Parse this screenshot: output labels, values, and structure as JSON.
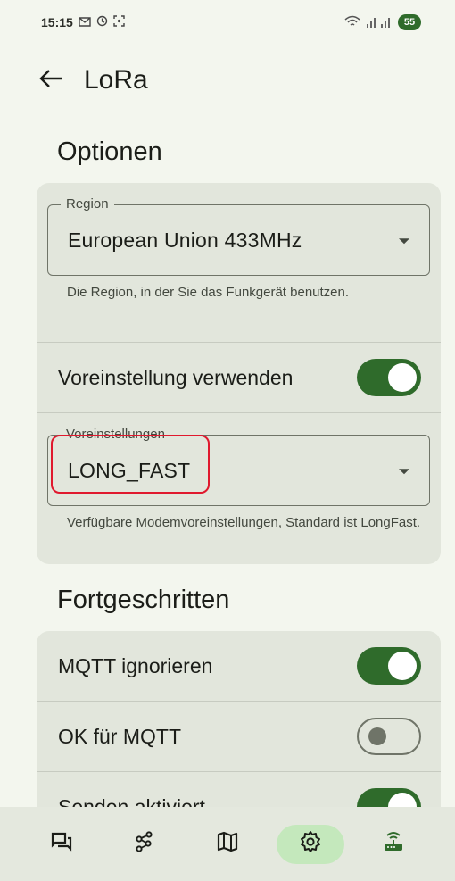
{
  "status_bar": {
    "time": "15:15",
    "left_icons": [
      "gmail-icon",
      "sync-icon",
      "screenshot-icon"
    ],
    "battery": "55"
  },
  "app_bar": {
    "title": "LoRa"
  },
  "sections": {
    "options_title": "Optionen",
    "advanced_title": "Fortgeschritten"
  },
  "region": {
    "legend": "Region",
    "value": "European Union 433MHz",
    "helper": "Die Region, in der Sie das Funkgerät benutzen."
  },
  "use_preset": {
    "label": "Voreinstellung verwenden",
    "checked": true
  },
  "presets": {
    "legend": "Voreinstellungen",
    "value": "LONG_FAST",
    "helper": "Verfügbare Modemvoreinstellungen, Standard ist LongFast."
  },
  "advanced": [
    {
      "label": "MQTT ignorieren",
      "checked": true
    },
    {
      "label": "OK für MQTT",
      "checked": false
    },
    {
      "label": "Senden aktiviert",
      "checked": true
    }
  ],
  "bottom_nav": [
    {
      "icon": "messages-icon",
      "active": false
    },
    {
      "icon": "nodes-icon",
      "active": false
    },
    {
      "icon": "map-icon",
      "active": false
    },
    {
      "icon": "settings-icon",
      "active": true
    },
    {
      "icon": "router-icon",
      "active": false
    }
  ],
  "colors": {
    "accent": "#2f6b2b",
    "background": "#f3f6ee",
    "card": "#e2e6dc",
    "highlight": "#e0192e",
    "nav_active": "#c4e8bc"
  }
}
